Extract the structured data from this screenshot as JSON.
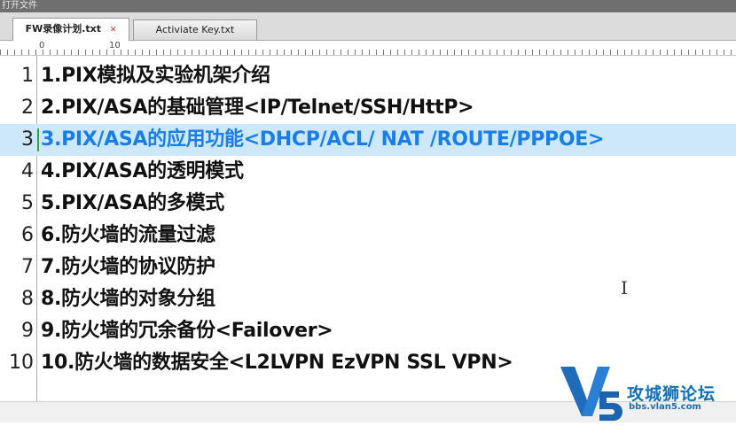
{
  "window": {
    "title": "打开文件"
  },
  "tabs": [
    {
      "label": "FW录像计划.txt",
      "active": true
    },
    {
      "label": "Activiate Key.txt",
      "active": false
    }
  ],
  "ruler": {
    "labels": [
      "0",
      "10"
    ]
  },
  "icons": {
    "tab_close": "close-icon",
    "dropdown": "chevron-down-icon",
    "cursor": "text-cursor-icon"
  },
  "editor": {
    "current_line": 3,
    "lines": [
      {
        "num": "1",
        "text": "1.PIX模拟及实验机架介绍"
      },
      {
        "num": "2",
        "text": "2.PIX/ASA的基础管理<IP/Telnet/SSH/HttP>"
      },
      {
        "num": "3",
        "text": "3.PIX/ASA的应用功能<DHCP/ACL/ NAT /ROUTE/PPPOE>"
      },
      {
        "num": "4",
        "text": "4.PIX/ASA的透明模式"
      },
      {
        "num": "5",
        "text": "5.PIX/ASA的多模式"
      },
      {
        "num": "6",
        "text": "6.防火墙的流量过滤"
      },
      {
        "num": "7",
        "text": "7.防火墙的协议防护"
      },
      {
        "num": "8",
        "text": "8.防火墙的对象分组"
      },
      {
        "num": "9",
        "text": "9.防火墙的冗余备份<Failover>"
      },
      {
        "num": "10",
        "text": "10.防火墙的数据安全<L2LVPN EzVPN SSL VPN>"
      }
    ]
  },
  "watermark": {
    "logo_text": "V5",
    "site_name": "攻城狮论坛",
    "url": "bbs.vlan5.com"
  },
  "colors": {
    "current_line_bg": "#cde8fb",
    "current_line_text": "#1a7ee8",
    "accent": "#0f6fb8"
  }
}
